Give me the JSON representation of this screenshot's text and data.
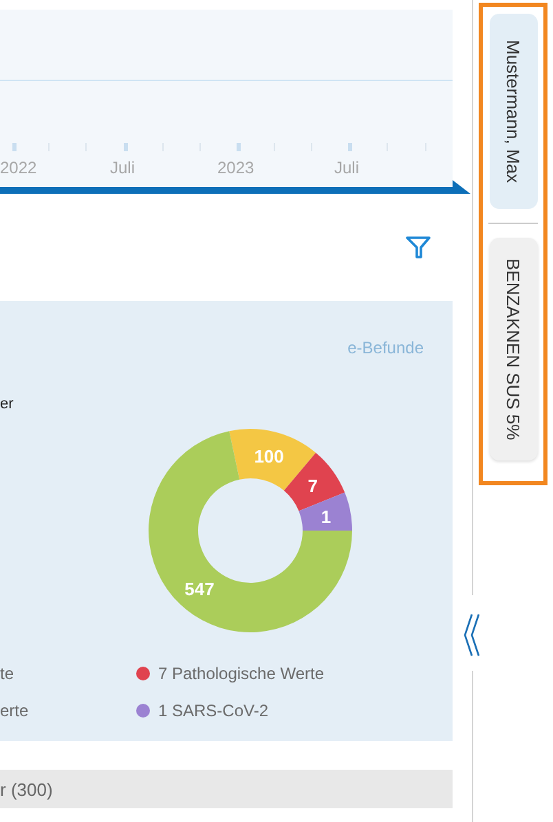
{
  "timeline": {
    "labels": [
      "2022",
      "Juli",
      "2023",
      "Juli"
    ]
  },
  "card": {
    "link": "e-Befunde",
    "heading": "er",
    "donut": [
      {
        "label": "547",
        "color": "#abcd5a"
      },
      {
        "label": "100",
        "color": "#f4c744"
      },
      {
        "label": "7",
        "color": "#e0434f"
      },
      {
        "label": "1",
        "color": "#9b82d2"
      }
    ],
    "legend": [
      {
        "label": "te"
      },
      {
        "label": "7 Pathologische Werte",
        "color": "#e0434f"
      },
      {
        "label": "erte"
      },
      {
        "label": "1 SARS-CoV-2",
        "color": "#9b82d2"
      }
    ]
  },
  "section_bar": {
    "label": "r (300)"
  },
  "side_tabs": [
    {
      "label": "Mustermann, Max",
      "selected": true
    },
    {
      "label": "BENZAKNEN SUS 5%",
      "selected": false
    }
  ]
}
